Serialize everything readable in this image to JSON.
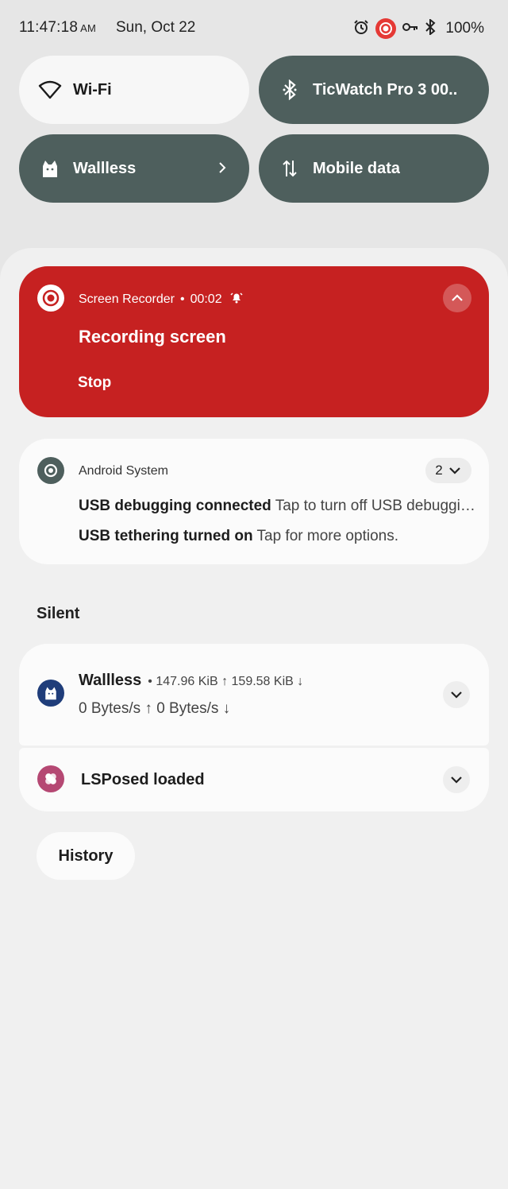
{
  "status_bar": {
    "time": "11:47:18",
    "ampm": "AM",
    "date": "Sun, Oct 22",
    "battery": "100%",
    "icons": [
      "alarm-icon",
      "screen-record-icon",
      "vpn-key-icon",
      "bluetooth-icon"
    ]
  },
  "quick_tiles": [
    {
      "label": "Wi-Fi",
      "icon": "wifi-icon",
      "state": "off"
    },
    {
      "label": "TicWatch Pro 3 00..",
      "icon": "bluetooth-icon",
      "state": "on"
    },
    {
      "label": "Wallless",
      "icon": "cat-icon",
      "state": "on"
    },
    {
      "label": "Mobile data",
      "icon": "data-arrows-icon",
      "state": "on"
    }
  ],
  "recorder_notification": {
    "app": "Screen Recorder",
    "time": "00:02",
    "title": "Recording screen",
    "action": "Stop",
    "color": "#c62121"
  },
  "system_notification": {
    "app": "Android System",
    "count": "2",
    "lines": [
      {
        "title": "USB debugging connected",
        "text": "Tap to turn off USB debugging"
      },
      {
        "title": "USB tethering turned on",
        "text": "Tap for more options."
      }
    ]
  },
  "silent_section": {
    "label": "Silent",
    "wallless": {
      "name": "Wallless",
      "meta": "• 147.96 KiB ↑ 159.58 KiB ↓",
      "speed": "0 Bytes/s ↑   0 Bytes/s ↓"
    },
    "lsposed": {
      "title": "LSPosed loaded"
    }
  },
  "history_button": "History",
  "colors": {
    "tile_dark": "#4e5f5d",
    "tile_light": "#f7f7f7",
    "recorder_red": "#c62121",
    "wallless_blue": "#1f3d7a",
    "lsposed_pink": "#b54873"
  }
}
